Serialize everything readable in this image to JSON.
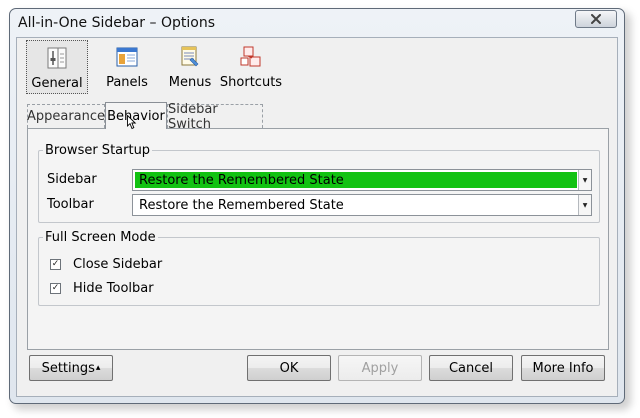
{
  "window": {
    "title": "All-in-One Sidebar – Options"
  },
  "categories": [
    {
      "label": "General",
      "icon": "settings-panel-icon",
      "selected": true
    },
    {
      "label": "Panels",
      "icon": "panels-window-icon"
    },
    {
      "label": "Menus",
      "icon": "menus-icon"
    },
    {
      "label": "Shortcuts",
      "icon": "shortcuts-icon"
    }
  ],
  "tabs": [
    {
      "label": "Appearance"
    },
    {
      "label": "Behavior",
      "active": true
    },
    {
      "label": "Sidebar Switch"
    }
  ],
  "browser_startup": {
    "legend": "Browser Startup",
    "sidebar": {
      "label": "Sidebar",
      "value": "Restore the Remembered State"
    },
    "toolbar": {
      "label": "Toolbar",
      "value": "Restore the Remembered State"
    }
  },
  "full_screen": {
    "legend": "Full Screen Mode",
    "close_sidebar": {
      "label": "Close Sidebar",
      "checked": true
    },
    "hide_toolbar": {
      "label": "Hide Toolbar",
      "checked": true
    }
  },
  "buttons": {
    "settings": "Settings",
    "settings_indicator": "▴",
    "ok": "OK",
    "apply": "Apply",
    "cancel": "Cancel",
    "more_info": "More Info"
  },
  "colors": {
    "focused_selection": "#12c212"
  }
}
